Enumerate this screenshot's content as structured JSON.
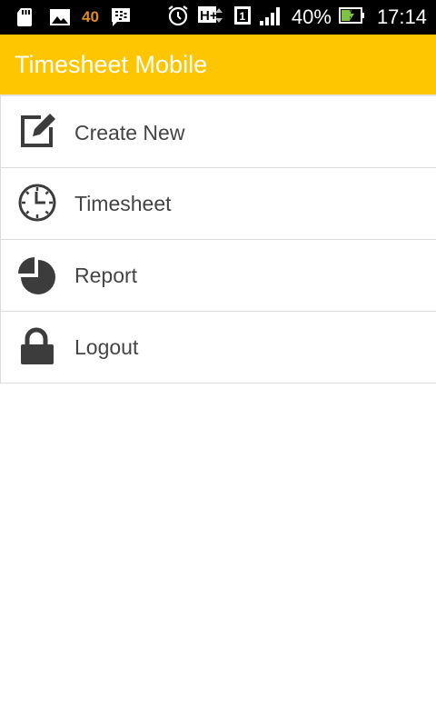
{
  "status_bar": {
    "notification_count": "40",
    "battery_percent": "40%",
    "time": "17:14",
    "network_type": "H+",
    "sim_slot": "1"
  },
  "app_bar": {
    "title": "Timesheet Mobile",
    "color": "#fdc600"
  },
  "menu": {
    "items": [
      {
        "label": "Create New",
        "icon": "edit-icon"
      },
      {
        "label": "Timesheet",
        "icon": "clock-icon"
      },
      {
        "label": "Report",
        "icon": "pie-chart-icon"
      },
      {
        "label": "Logout",
        "icon": "lock-icon"
      }
    ]
  }
}
